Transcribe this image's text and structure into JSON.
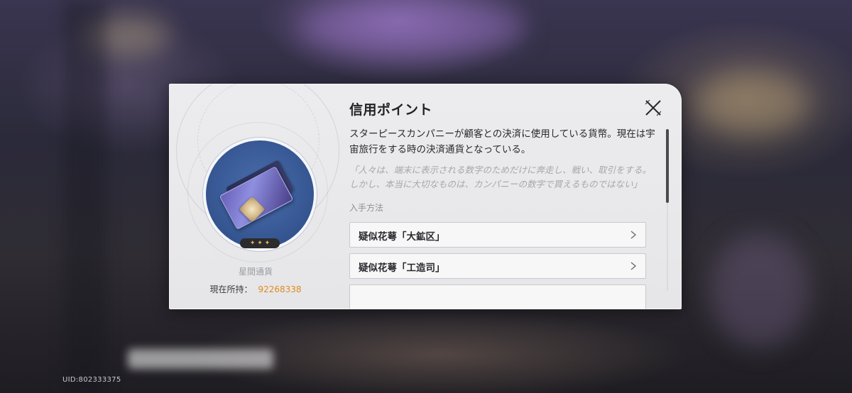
{
  "background": {
    "uid_text": "UID:802333375"
  },
  "dialog": {
    "title": "信用ポイント",
    "close_icon": "close-x-icon",
    "description": "スターピースカンパニーが顧客との決済に使用している貨幣。現在は宇宙旅行をする時の決済通貨となっている。",
    "quote": "「人々は、端末に表示される数字のためだけに奔走し、戦い、取引をする。しかし、本当に大切なものは、カンパニーの数字で買えるものではない」",
    "acquire_label": "入手方法",
    "sources": [
      {
        "label": "疑似花萼「大鉱区」",
        "icon": "chevron-right-icon"
      },
      {
        "label": "疑似花萼「工造司」",
        "icon": "chevron-right-icon"
      }
    ]
  },
  "item": {
    "icon": "credit-card-icon",
    "rarity_stars": "✦ ✦ ✦",
    "rarity_count": 3,
    "type_label": "星間通貨",
    "owned_label": "現在所持：",
    "owned_value": "92268338"
  },
  "colors": {
    "accent_owned": "#e08a1e",
    "rarity_star": "#e8b64a",
    "dialog_bg": "#ececee"
  }
}
